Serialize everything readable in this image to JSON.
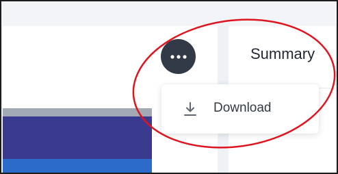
{
  "panel": {
    "summary_title": "Summary"
  },
  "more_button": {
    "icon": "more-horizontal-icon"
  },
  "context_menu": {
    "items": [
      {
        "label": "Download",
        "icon": "download-icon"
      }
    ]
  },
  "colors": {
    "chart_header": "#a3aab5",
    "chart_purple": "#3a3a8e",
    "chart_blue": "#2d6bcb",
    "more_button_bg": "#313a46",
    "annotation_circle": "#e0141e"
  }
}
